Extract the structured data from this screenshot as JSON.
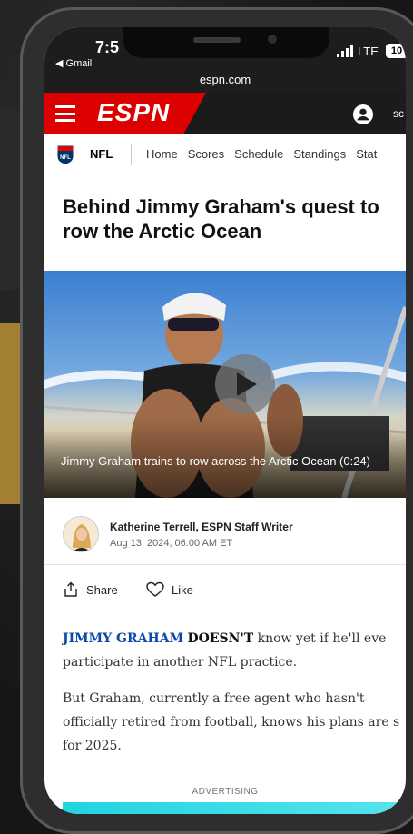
{
  "status": {
    "time": "7:5",
    "back_app": "◀ Gmail",
    "network": "LTE",
    "battery": "10",
    "url": "espn.com"
  },
  "header": {
    "logo": "ESPN",
    "search_partial": "sc"
  },
  "nav": {
    "league": "NFL",
    "links": [
      "Home",
      "Scores",
      "Schedule",
      "Standings",
      "Stat"
    ]
  },
  "article": {
    "headline": [
      "Behind Jimmy Graham's quest to",
      "row the Arctic Ocean"
    ],
    "video_caption": "Jimmy Graham trains to row across the Arctic Ocean (0:24)",
    "author": "Katherine Terrell, ESPN Staff Writer",
    "date": "Aug 13, 2024, 06:00 AM ET",
    "share_label": "Share",
    "like_label": "Like",
    "p1_lead_name": "JIMMY GRAHAM",
    "p1_lead_word": "DOESN'T",
    "p1_rest": " know yet if he'll eve",
    "p1_line2": "participate in another NFL practice.",
    "p2_line1": "But Graham, currently a free agent who hasn't",
    "p2_line2": "officially retired from football, knows his plans are s",
    "p2_line3": "for 2025.",
    "advertising": "ADVERTISING"
  },
  "colors": {
    "espn_red": "#dd0000",
    "link_blue": "#0b4aa8",
    "ad_cyan": "#21d4e0"
  }
}
